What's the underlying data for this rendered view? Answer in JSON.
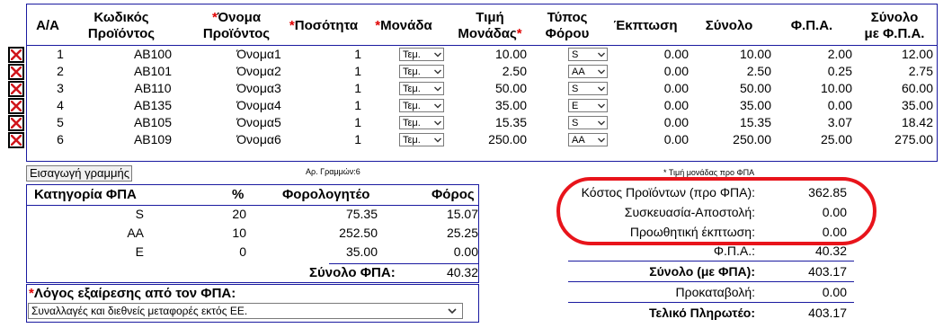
{
  "items_table": {
    "headers": {
      "aa": "Α/Α",
      "code": [
        "Κωδικός",
        "Προϊόντος"
      ],
      "name": [
        "Όνομα",
        "Προϊόντος"
      ],
      "qty": "Ποσότητα",
      "unit": "Μονάδα",
      "price": [
        "Τιμή",
        "Μονάδας"
      ],
      "taxtype": [
        "Τύπος",
        "Φόρου"
      ],
      "discount": "Έκπτωση",
      "total": "Σύνολο",
      "vat": "Φ.Π.Α.",
      "total_vat": [
        "Σύνολο",
        "με Φ.Π.Α."
      ]
    },
    "rows": [
      {
        "aa": "1",
        "code": "AB100",
        "name": "Όνομα1",
        "qty": "1",
        "unit": "Τεμ.",
        "price": "10.00",
        "tax": "S",
        "discount": "0.00",
        "total": "10.00",
        "vat": "2.00",
        "total_vat": "12.00"
      },
      {
        "aa": "2",
        "code": "AB101",
        "name": "Όνομα2",
        "qty": "1",
        "unit": "Τεμ.",
        "price": "2.50",
        "tax": "AA",
        "discount": "0.00",
        "total": "2.50",
        "vat": "0.25",
        "total_vat": "2.75"
      },
      {
        "aa": "3",
        "code": "AB110",
        "name": "Όνομα3",
        "qty": "1",
        "unit": "Τεμ.",
        "price": "50.00",
        "tax": "S",
        "discount": "0.00",
        "total": "50.00",
        "vat": "10.00",
        "total_vat": "60.00"
      },
      {
        "aa": "4",
        "code": "AB135",
        "name": "Όνομα4",
        "qty": "1",
        "unit": "Τεμ.",
        "price": "35.00",
        "tax": "E",
        "discount": "0.00",
        "total": "35.00",
        "vat": "0.00",
        "total_vat": "35.00"
      },
      {
        "aa": "5",
        "code": "AB105",
        "name": "Όνομα5",
        "qty": "1",
        "unit": "Τεμ.",
        "price": "15.35",
        "tax": "S",
        "discount": "0.00",
        "total": "15.35",
        "vat": "3.07",
        "total_vat": "18.42"
      },
      {
        "aa": "6",
        "code": "AB109",
        "name": "Όνομα6",
        "qty": "1",
        "unit": "Τεμ.",
        "price": "250.00",
        "tax": "AA",
        "discount": "0.00",
        "total": "250.00",
        "vat": "25.00",
        "total_vat": "275.00"
      }
    ]
  },
  "add_row_label": "Εισαγωγή γραμμής",
  "row_count_note": "Αρ. Γραμμών:6",
  "price_note": "* Τιμή μονάδας προ ΦΠΑ",
  "vat_table": {
    "headers": {
      "category": "Κατηγορία ΦΠΑ",
      "percent": "%",
      "taxable": "Φορολογητέο",
      "tax": "Φόρος"
    },
    "rows": [
      {
        "category": "S",
        "percent": "20",
        "taxable": "75.35",
        "tax": "15.07"
      },
      {
        "category": "AA",
        "percent": "10",
        "taxable": "252.50",
        "tax": "25.25"
      },
      {
        "category": "E",
        "percent": "0",
        "taxable": "35.00",
        "tax": "0.00"
      }
    ],
    "total_label": "Σύνολο ΦΠΑ:",
    "total_value": "40.32"
  },
  "exemption": {
    "label": "Λόγος εξαίρεσης από τον ΦΠΑ:",
    "selected": "Συναλλαγές και διεθνείς μεταφορές εκτός ΕΕ."
  },
  "totals": {
    "cost_label": "Κόστος Προϊόντων (προ ΦΠΑ):",
    "cost_value": "362.85",
    "packaging_label": "Συσκευασία-Αποστολή:",
    "packaging_value": "0.00",
    "promo_label": "Προωθητική έκπτωση:",
    "promo_value": "0.00",
    "vat_label": "Φ.Π.Α.:",
    "vat_value": "40.32",
    "total_label": "Σύνολο (με ΦΠΑ):",
    "total_value": "403.17",
    "advance_label": "Προκαταβολή:",
    "advance_value": "0.00",
    "final_label": "Τελικό Πληρωτέο:",
    "final_value": "403.17"
  },
  "colors": {
    "border": "#1a1aa0",
    "required": "#e00000",
    "highlight": "#e8141b"
  }
}
